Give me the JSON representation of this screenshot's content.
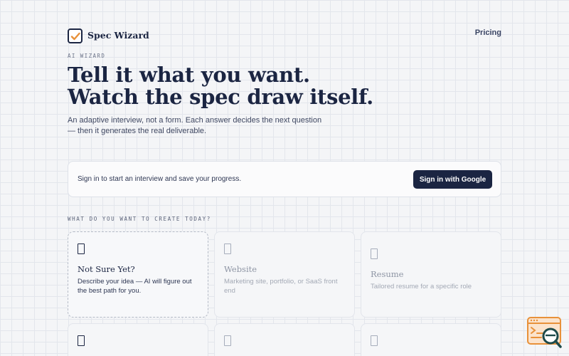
{
  "header": {
    "brand": "Spec Wizard",
    "pricing_label": "Pricing"
  },
  "hero": {
    "eyebrow": "AI WIZARD",
    "headline_line1": "Tell it what you want.",
    "headline_line2": "Watch the spec draw itself.",
    "subhead": "An adaptive interview, not a form. Each answer decides the next question — then it generates the real deliverable."
  },
  "signin": {
    "prompt": "Sign in to start an interview and save your progress.",
    "button_label": "Sign in with Google"
  },
  "section_label": "WHAT DO YOU WANT TO CREATE TODAY?",
  "cards": [
    {
      "title": "Not Sure Yet?",
      "description": "Describe your idea — AI will figure out the best path for you.",
      "icon": "document-icon"
    },
    {
      "title": "Website",
      "description": "Marketing site, portfolio, or SaaS front end",
      "icon": "document-icon"
    },
    {
      "title": "Resume",
      "description": "Tailored resume for a specific role",
      "icon": "document-icon"
    },
    {
      "title": "",
      "description": "",
      "icon": "document-icon"
    },
    {
      "title": "",
      "description": "",
      "icon": "document-icon"
    },
    {
      "title": "",
      "description": "",
      "icon": "document-icon"
    }
  ],
  "colors": {
    "primary": "#1b2542",
    "accent": "#e8913a",
    "background": "#f4f5f7"
  }
}
